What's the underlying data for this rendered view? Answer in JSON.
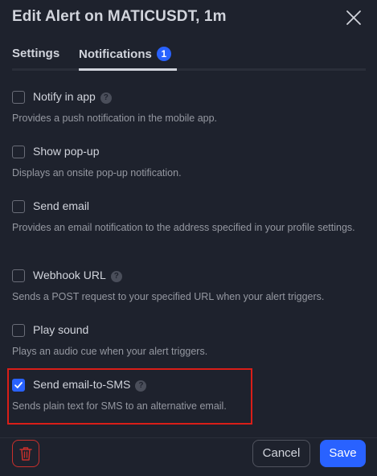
{
  "dialog": {
    "title": "Edit Alert on MATICUSDT, 1m"
  },
  "tabs": [
    {
      "label": "Settings",
      "active": false
    },
    {
      "label": "Notifications",
      "active": true,
      "badge": "1"
    }
  ],
  "options": [
    {
      "label": "Notify in app",
      "help": true,
      "checked": false,
      "description": "Provides a push notification in the mobile app."
    },
    {
      "label": "Show pop-up",
      "help": false,
      "checked": false,
      "description": "Displays an onsite pop-up notification."
    },
    {
      "label": "Send email",
      "help": false,
      "checked": false,
      "description": "Provides an email notification to the address specified in your profile settings."
    },
    {
      "label": "Webhook URL",
      "help": true,
      "checked": false,
      "description": "Sends a POST request to your specified URL when your alert triggers."
    },
    {
      "label": "Play sound",
      "help": false,
      "checked": false,
      "description": "Plays an audio cue when your alert triggers."
    },
    {
      "label": "Send email-to-SMS",
      "help": true,
      "checked": true,
      "description": "Sends plain text for SMS to an alternative email."
    }
  ],
  "help_glyph": "?",
  "footer": {
    "cancel_label": "Cancel",
    "save_label": "Save"
  },
  "colors": {
    "accent": "#2962ff",
    "delete": "#c9302c",
    "highlight": "#d91e18",
    "background": "#1e222d"
  },
  "icons": {
    "close": "close-icon",
    "delete": "trash-icon",
    "check": "checkmark-icon",
    "help": "question-icon"
  }
}
